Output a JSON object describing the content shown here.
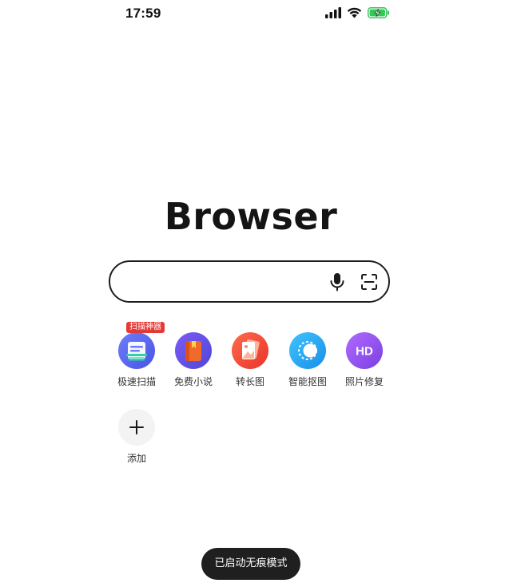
{
  "status_bar": {
    "time": "17:59",
    "icons": [
      "signal-icon",
      "wifi-icon",
      "battery-charging-icon"
    ]
  },
  "brand": {
    "logo_text": "Browser"
  },
  "search": {
    "value": "",
    "placeholder": "",
    "icons": [
      "microphone-icon",
      "scan-icon"
    ]
  },
  "shortcuts": [
    {
      "label": "极速扫描",
      "badge": "扫描神器",
      "icon": "scan-document-icon",
      "color": "#5b6cf0"
    },
    {
      "label": "免费小说",
      "icon": "book-icon",
      "color": "#f06a2a"
    },
    {
      "label": "转长图",
      "icon": "long-image-icon",
      "color": "#f24c3d"
    },
    {
      "label": "智能抠图",
      "icon": "cutout-icon",
      "color": "#2aa8f2"
    },
    {
      "label": "照片修复",
      "icon": "hd-icon",
      "icon_text": "HD",
      "color": "#9b5cf2"
    },
    {
      "label": "添加",
      "icon": "plus-icon"
    }
  ],
  "toast": {
    "text": "已启动无痕模式"
  },
  "colors": {
    "background": "#ffffff",
    "text": "#1a1a1a",
    "badge": "#e53935",
    "toast_bg": "#1f1f1f"
  }
}
